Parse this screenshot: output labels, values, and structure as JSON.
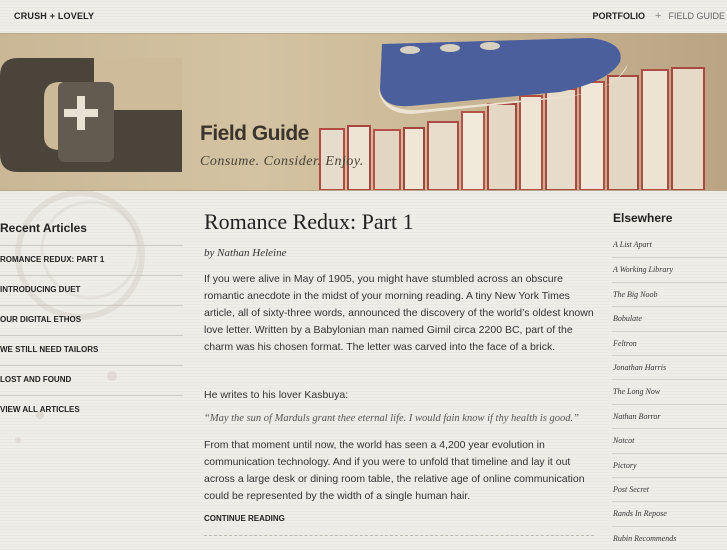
{
  "header": {
    "brand": "CRUSH + LOVELY",
    "nav": {
      "portfolio": "PORTFOLIO",
      "separator": "+",
      "current": "FIELD GUIDE"
    }
  },
  "banner": {
    "title": "Field Guide",
    "tagline": "Consume. Consider. Enjoy."
  },
  "sidebar": {
    "heading": "Recent Articles",
    "items": [
      {
        "label": "ROMANCE REDUX: PART 1"
      },
      {
        "label": "INTRODUCING DUET"
      },
      {
        "label": "OUR DIGITAL ETHOS"
      },
      {
        "label": "WE STILL NEED TAILORS"
      },
      {
        "label": "LOST AND FOUND"
      },
      {
        "label": "VIEW ALL ARTICLES"
      }
    ]
  },
  "article": {
    "title": "Romance Redux: Part 1",
    "byline": "by Nathan Heleine",
    "p1": "If you were alive in May of 1905, you might have stumbled across an obscure romantic anecdote in the midst of your morning reading. A tiny New York Times article, all of sixty-three words, announced the discovery of the world’s oldest known love letter. Written by a Babylonian man named Gimil circa 2200 BC, part of the charm was his chosen format. The letter was carved into the face of a brick.",
    "p2": "He writes to his lover Kasbuya:",
    "quote": "“May the sun of Marduls grant thee eternal life. I would fain know if thy health is good.”",
    "p3": "From that moment until now, the world has seen a 4,200 year evolution in communication technology. And if you were to unfold that timeline and lay it out across a large desk or dining room table, the relative age of online communication could be represented by the width of a single human hair.",
    "continue": "CONTINUE READING"
  },
  "elsewhere": {
    "heading": "Elsewhere",
    "links": [
      {
        "label": "A List Apart"
      },
      {
        "label": "A Working Library"
      },
      {
        "label": "The Big Noob"
      },
      {
        "label": "Bobulate"
      },
      {
        "label": "Feltron"
      },
      {
        "label": "Jonathan Harris"
      },
      {
        "label": "The Long Now"
      },
      {
        "label": "Nathan Borror"
      },
      {
        "label": "Notcot"
      },
      {
        "label": "Pictory"
      },
      {
        "label": "Post Secret"
      },
      {
        "label": "Rands In Repose"
      },
      {
        "label": "Rubin Recommends"
      }
    ]
  },
  "colors": {
    "background": "#efede8",
    "banner": "#cdbb99",
    "logo": "#4a443b",
    "text": "#2b2b2b"
  }
}
